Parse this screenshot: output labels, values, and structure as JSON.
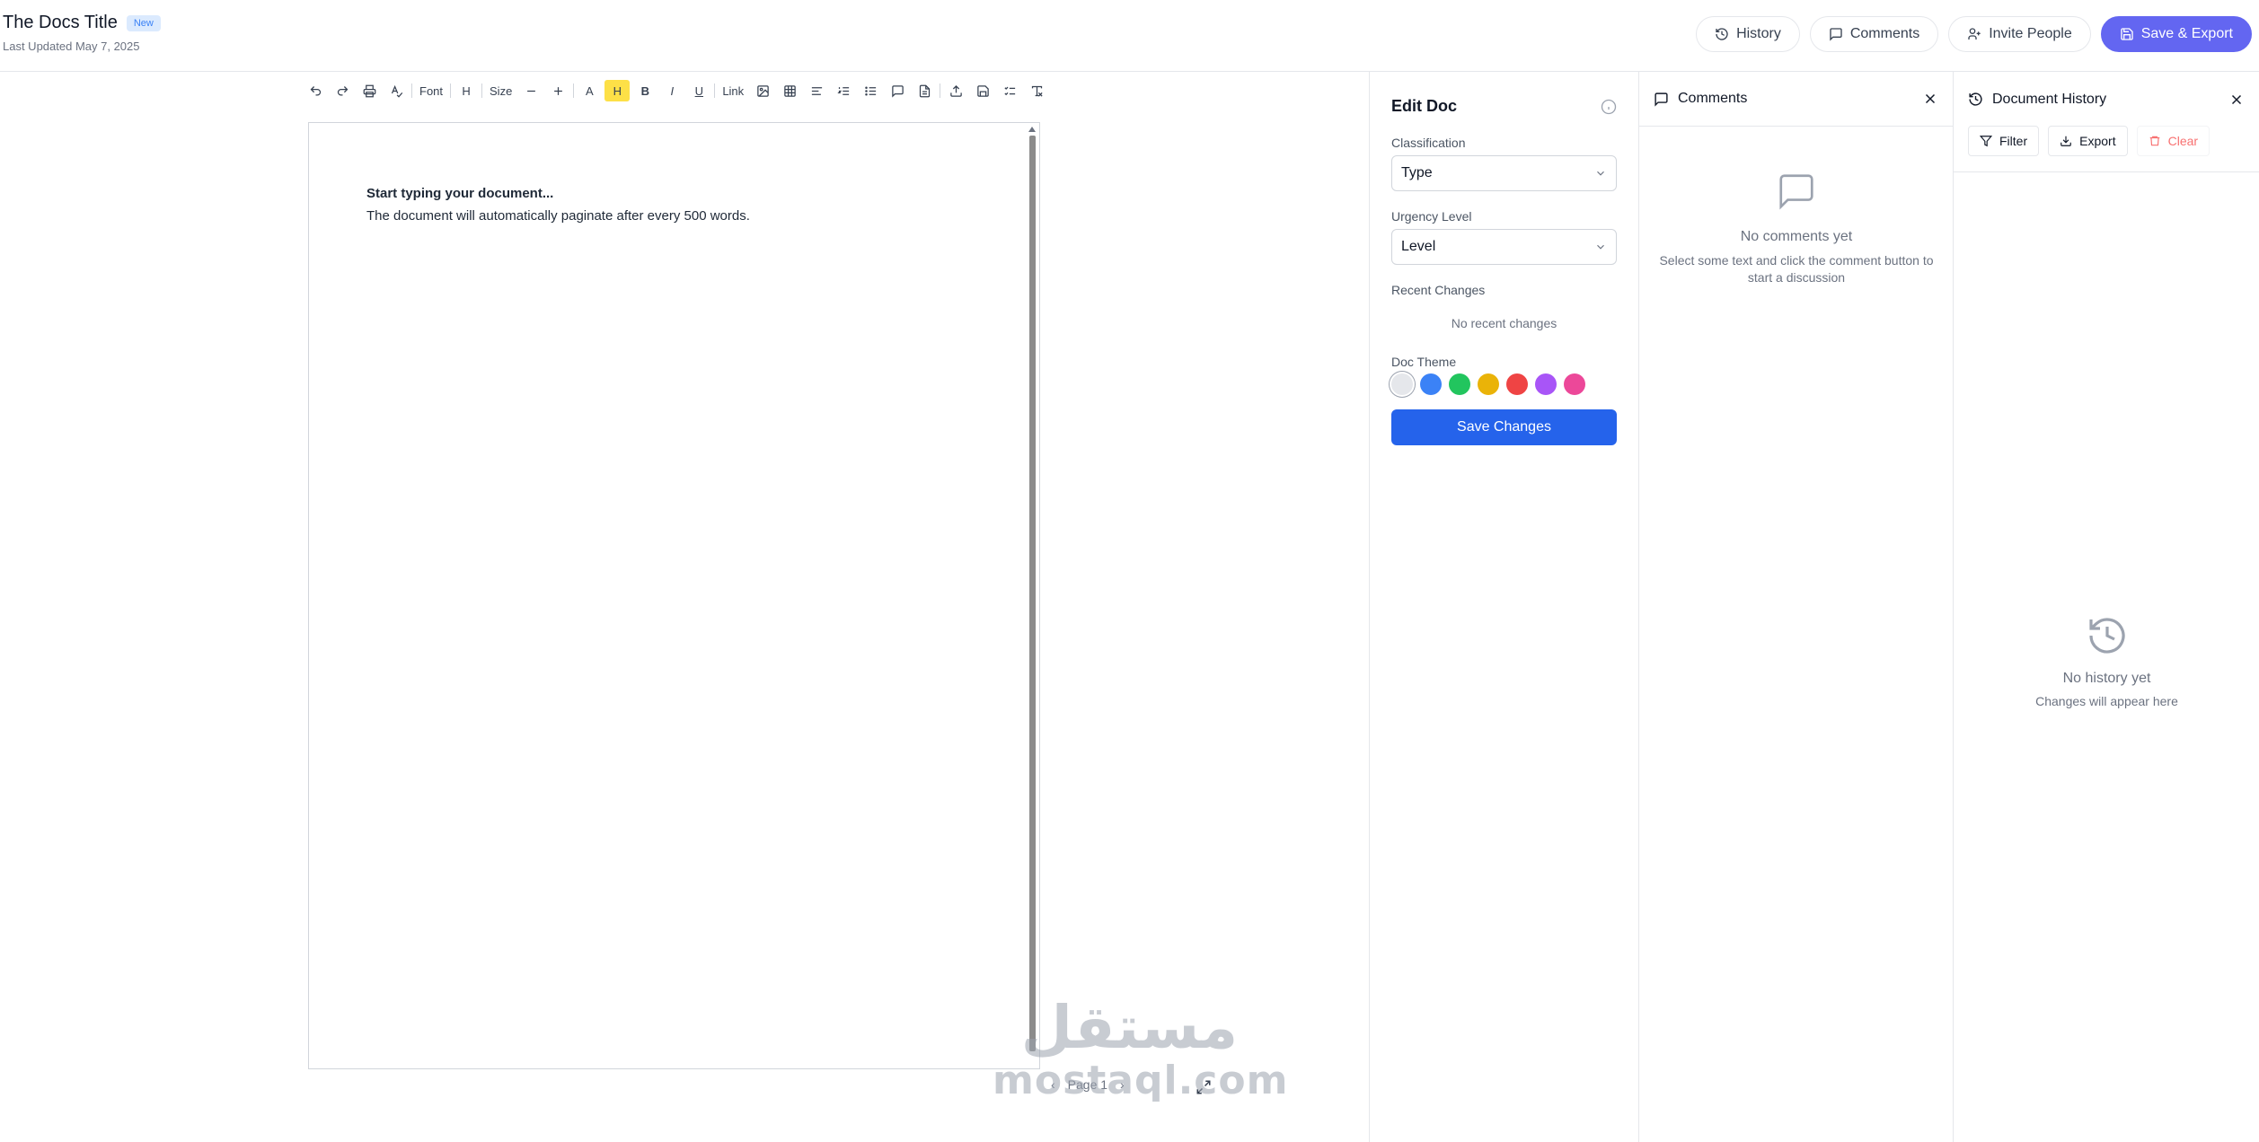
{
  "header": {
    "title": "The Docs Title",
    "badge": "New",
    "last_updated": "Last Updated May 7, 2025",
    "buttons": {
      "history": "History",
      "comments": "Comments",
      "invite": "Invite People",
      "save_export": "Save & Export"
    }
  },
  "toolbar": {
    "font": "Font",
    "heading": "H",
    "size": "Size",
    "text_color": "A",
    "highlight": "H",
    "bold": "B",
    "italic": "I",
    "underline": "U",
    "link": "Link",
    "highlight_color": "#fde047"
  },
  "editor": {
    "line1": "Start typing your document...",
    "line2": "The document will automatically paginate after every 500 words.",
    "page_label": "Page 1"
  },
  "edit_panel": {
    "title": "Edit Doc",
    "classification_label": "Classification",
    "classification_value": "Type",
    "urgency_label": "Urgency Level",
    "urgency_value": "Level",
    "recent_label": "Recent Changes",
    "recent_empty": "No recent changes",
    "theme_label": "Doc Theme",
    "theme_colors": [
      "#e5e7eb",
      "#3b82f6",
      "#22c55e",
      "#eab308",
      "#ef4444",
      "#a855f7",
      "#ec4899"
    ],
    "save_label": "Save Changes"
  },
  "comments_panel": {
    "title": "Comments",
    "empty_title": "No comments yet",
    "empty_text": "Select some text and click the comment button to start a discussion"
  },
  "history_panel": {
    "title": "Document History",
    "filter": "Filter",
    "export": "Export",
    "clear": "Clear",
    "empty_title": "No history yet",
    "empty_text": "Changes will appear here"
  },
  "watermark": {
    "arabic": "مستقل",
    "latin": "mostaql.com"
  },
  "colors": {
    "primary": "#6366f1",
    "save_blue": "#2563eb",
    "badge_bg": "#dbeafe",
    "badge_text": "#3b82f6"
  }
}
